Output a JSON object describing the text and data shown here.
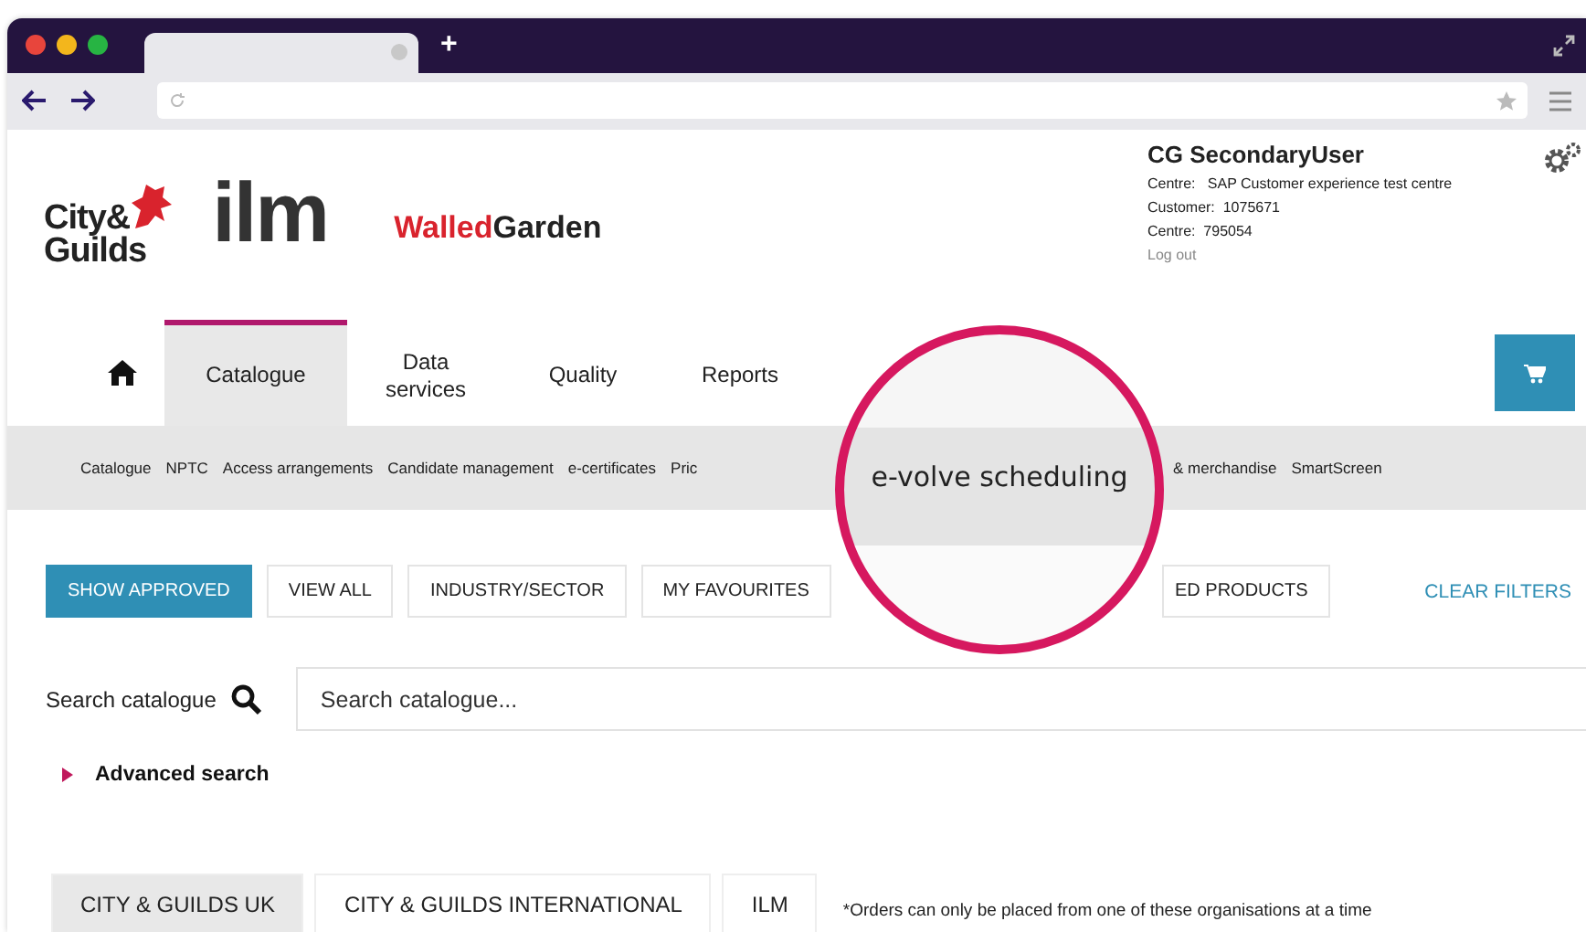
{
  "browser": {
    "new_tab": "+"
  },
  "logos": {
    "cg_top": "City&",
    "cg_bottom": "Guilds",
    "ilm": "ilm",
    "brand_first": "Walled",
    "brand_second": "Garden"
  },
  "user": {
    "name": "CG SecondaryUser",
    "lines": [
      "Centre:   SAP Customer experience test centre",
      "Customer:  1075671",
      "Centre:  795054"
    ],
    "logout": "Log out"
  },
  "nav": [
    {
      "label": "Catalogue",
      "selected": true
    },
    {
      "label": "Data services",
      "selected": false
    },
    {
      "label": "Quality",
      "selected": false
    },
    {
      "label": "Reports",
      "selected": false
    }
  ],
  "subnav_left": [
    "Catalogue",
    "NPTC",
    "Access arrangements",
    "Candidate management",
    "e-certificates",
    "Pric"
  ],
  "subnav_right": [
    "& merchandise",
    "SmartScreen"
  ],
  "magnifier": {
    "text": "e-volve scheduling"
  },
  "filters": [
    {
      "label": "SHOW APPROVED",
      "selected": true
    },
    {
      "label": "VIEW ALL",
      "selected": false
    },
    {
      "label": "INDUSTRY/SECTOR",
      "selected": false
    },
    {
      "label": "MY FAVOURITES",
      "selected": false
    },
    {
      "label": "ED PRODUCTS",
      "selected": false
    }
  ],
  "clear_filters": "CLEAR FILTERS",
  "search": {
    "label": "Search catalogue",
    "placeholder": "Search catalogue..."
  },
  "advanced": {
    "label": "Advanced search",
    "expanded": false
  },
  "orgs": [
    {
      "label": "CITY & GUILDS UK",
      "selected": true
    },
    {
      "label": "CITY & GUILDS INTERNATIONAL",
      "selected": false
    },
    {
      "label": "ILM",
      "selected": false
    }
  ],
  "orgs_note": "*Orders can only be placed from one of these organisations at a time"
}
